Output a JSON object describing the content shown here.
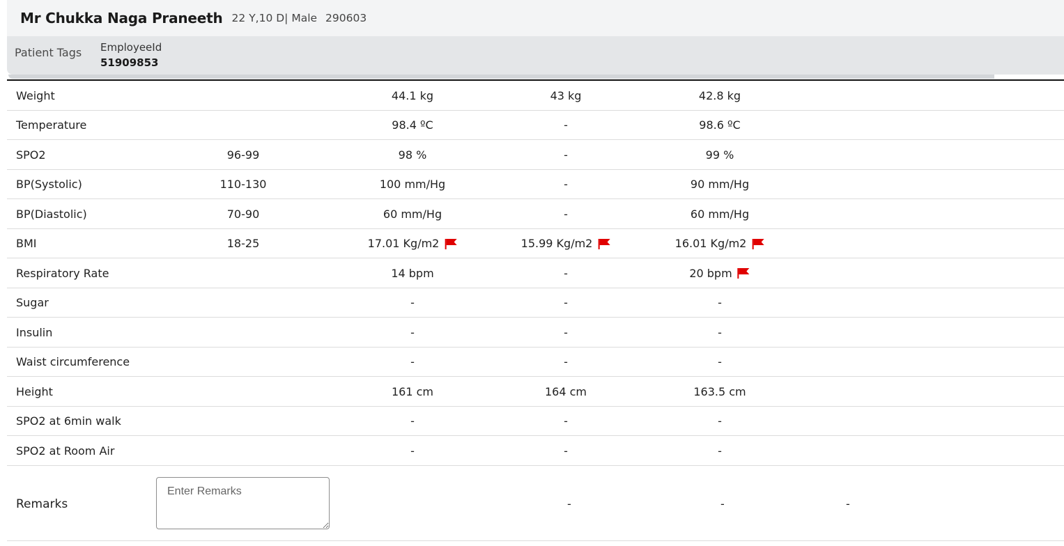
{
  "patient": {
    "name": "Mr Chukka Naga Praneeth",
    "meta": "22 Y,10 D| Male",
    "id": "290603"
  },
  "tags": {
    "label": "Patient Tags",
    "key": "EmployeeId",
    "value": "51909853"
  },
  "colors": {
    "flag": "#e00000",
    "header_bg": "#f3f4f5",
    "tags_bg": "#e4e6e8"
  },
  "rows": [
    {
      "name": "Weight",
      "range": "",
      "v1": "44.1 kg",
      "v2": "43 kg",
      "v3": "42.8 kg",
      "f1": false,
      "f2": false,
      "f3": false
    },
    {
      "name": "Temperature",
      "range": "",
      "v1": "98.4 ºC",
      "v2": "-",
      "v3": "98.6 ºC",
      "f1": false,
      "f2": false,
      "f3": false
    },
    {
      "name": "SPO2",
      "range": "96-99",
      "v1": "98 %",
      "v2": "-",
      "v3": "99 %",
      "f1": false,
      "f2": false,
      "f3": false
    },
    {
      "name": "BP(Systolic)",
      "range": "110-130",
      "v1": "100 mm/Hg",
      "v2": "-",
      "v3": "90 mm/Hg",
      "f1": false,
      "f2": false,
      "f3": false
    },
    {
      "name": "BP(Diastolic)",
      "range": "70-90",
      "v1": "60 mm/Hg",
      "v2": "-",
      "v3": "60 mm/Hg",
      "f1": false,
      "f2": false,
      "f3": false
    },
    {
      "name": "BMI",
      "range": "18-25",
      "v1": "17.01 Kg/m2",
      "v2": "15.99 Kg/m2",
      "v3": "16.01 Kg/m2",
      "f1": true,
      "f2": true,
      "f3": true
    },
    {
      "name": "Respiratory Rate",
      "range": "",
      "v1": "14 bpm",
      "v2": "-",
      "v3": "20 bpm",
      "f1": false,
      "f2": false,
      "f3": true
    },
    {
      "name": "Sugar",
      "range": "",
      "v1": "-",
      "v2": "-",
      "v3": "-",
      "f1": false,
      "f2": false,
      "f3": false
    },
    {
      "name": "Insulin",
      "range": "",
      "v1": "-",
      "v2": "-",
      "v3": "-",
      "f1": false,
      "f2": false,
      "f3": false
    },
    {
      "name": "Waist circumference",
      "range": "",
      "v1": "-",
      "v2": "-",
      "v3": "-",
      "f1": false,
      "f2": false,
      "f3": false
    },
    {
      "name": "Height",
      "range": "",
      "v1": "161 cm",
      "v2": "164 cm",
      "v3": "163.5 cm",
      "f1": false,
      "f2": false,
      "f3": false
    },
    {
      "name": "SPO2 at 6min walk",
      "range": "",
      "v1": "-",
      "v2": "-",
      "v3": "-",
      "f1": false,
      "f2": false,
      "f3": false
    },
    {
      "name": "SPO2 at Room Air",
      "range": "",
      "v1": "-",
      "v2": "-",
      "v3": "-",
      "f1": false,
      "f2": false,
      "f3": false
    }
  ],
  "remarks": {
    "label": "Remarks",
    "placeholder": "Enter Remarks",
    "values": [
      "-",
      "-",
      "-"
    ]
  }
}
